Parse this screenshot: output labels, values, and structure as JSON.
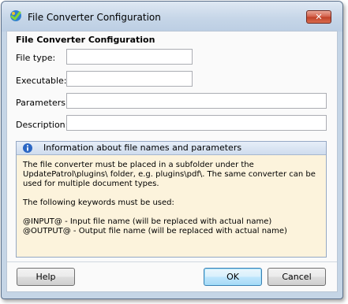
{
  "window": {
    "title": "File Converter Configuration",
    "close_symbol": "✕",
    "icon": "converter-app-icon"
  },
  "form": {
    "heading": "File Converter Configuration",
    "file_type": {
      "label": "File type:",
      "value": ""
    },
    "executable": {
      "label": "Executable:",
      "value": ""
    },
    "parameters": {
      "label": "Parameters:",
      "value": ""
    },
    "description": {
      "label": "Description:",
      "value": ""
    }
  },
  "info": {
    "icon": "info-icon",
    "title": "Information about file names and parameters",
    "line1": "The file converter must be placed in a subfolder under the",
    "line2": "UpdatePatrol\\plugins\\ folder, e.g. plugins\\pdf\\. The same converter can be",
    "line3": "used for multiple document types.",
    "line4": "The following keywords must be used:",
    "line5": "@INPUT@ - Input file name (will be replaced with actual name)",
    "line6": "@OUTPUT@ - Output file name (will be replaced with actual name)"
  },
  "buttons": {
    "help": "Help",
    "ok": "OK",
    "cancel": "Cancel"
  },
  "colors": {
    "title_bar": "#c6d6e8",
    "info_background": "#fcf3dc",
    "close_button": "#c04128",
    "default_button": "#bee6fd"
  }
}
